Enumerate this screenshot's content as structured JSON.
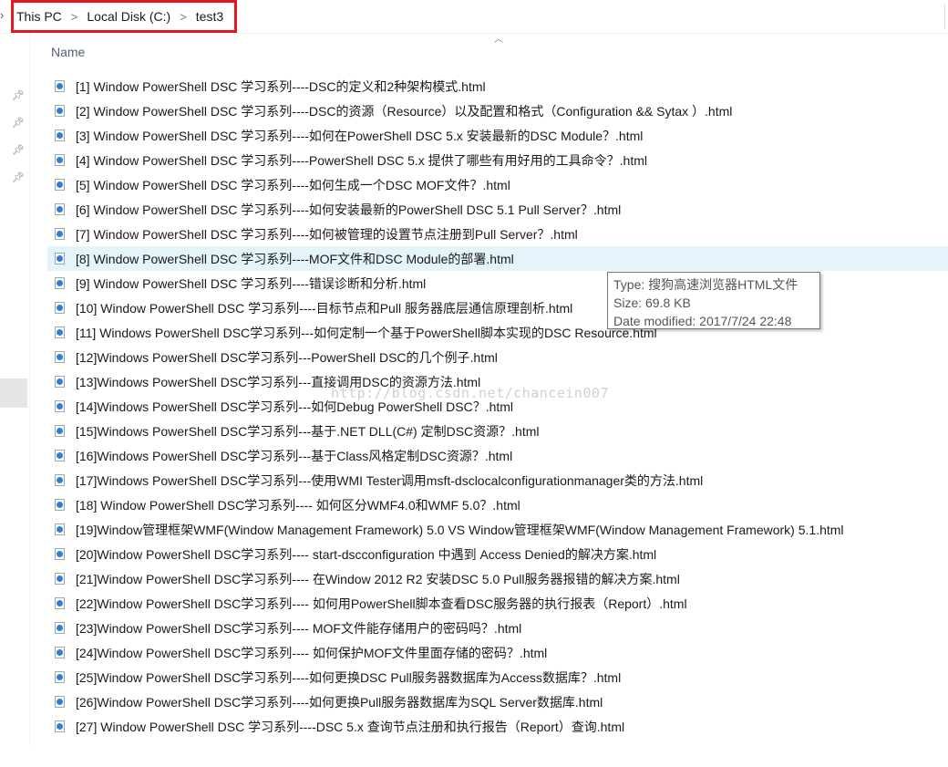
{
  "breadcrumb": {
    "items": [
      "This PC",
      "Local Disk (C:)",
      "test3"
    ],
    "separator": ">"
  },
  "header": {
    "name_column": "Name"
  },
  "files": [
    "[1] Window PowerShell DSC 学习系列----DSC的定义和2种架构模式.html",
    "[2] Window PowerShell DSC 学习系列----DSC的资源（Resource）以及配置和格式（Configuration && Sytax ）.html",
    "[3] Window PowerShell DSC 学习系列----如何在PowerShell DSC 5.x 安装最新的DSC Module？.html",
    "[4] Window PowerShell DSC 学习系列----PowerShell DSC 5.x 提供了哪些有用好用的工具命令？.html",
    "[5] Window PowerShell DSC 学习系列----如何生成一个DSC MOF文件？.html",
    "[6] Window PowerShell DSC 学习系列----如何安装最新的PowerShell DSC 5.1 Pull Server？.html",
    "[7] Window PowerShell DSC 学习系列----如何被管理的设置节点注册到Pull Server？.html",
    "[8] Window PowerShell DSC 学习系列----MOF文件和DSC Module的部署.html",
    "[9] Window PowerShell DSC 学习系列----错误诊断和分析.html",
    "[10] Window PowerShell DSC 学习系列----目标节点和Pull 服务器底层通信原理剖析.html",
    "[11] Windows PowerShell DSC学习系列---如何定制一个基于PowerShell脚本实现的DSC Resource.html",
    "[12]Windows PowerShell DSC学习系列---PowerShell DSC的几个例子.html",
    "[13]Windows PowerShell DSC学习系列---直接调用DSC的资源方法.html",
    "[14]Windows PowerShell DSC学习系列---如何Debug PowerShell DSC？.html",
    "[15]Windows PowerShell DSC学习系列---基于.NET DLL(C#) 定制DSC资源？.html",
    "[16]Windows PowerShell DSC学习系列---基于Class风格定制DSC资源？.html",
    "[17]Windows PowerShell DSC学习系列---使用WMI Tester调用msft-dsclocalconfigurationmanager类的方法.html",
    "[18] Window PowerShell DSC学习系列---- 如何区分WMF4.0和WMF 5.0？.html",
    "[19]Window管理框架WMF(Window Management Framework) 5.0 VS Window管理框架WMF(Window Management Framework) 5.1.html",
    "[20]Window PowerShell DSC学习系列---- start-dscconfiguration 中遇到 Access Denied的解决方案.html",
    "[21]Window PowerShell DSC学习系列---- 在Window 2012 R2 安装DSC 5.0 Pull服务器报错的解决方案.html",
    "[22]Window PowerShell DSC学习系列---- 如何用PowerShell脚本查看DSC服务器的执行报表（Report）.html",
    "[23]Window PowerShell DSC学习系列---- MOF文件能存储用户的密码吗？.html",
    "[24]Window PowerShell DSC学习系列---- 如何保护MOF文件里面存储的密码？.html",
    "[25]Window PowerShell DSC学习系列----如何更换DSC Pull服务器数据库为Access数据库？.html",
    "[26]Window PowerShell DSC学习系列----如何更换Pull服务器数据库为SQL Server数据库.html",
    "[27] Window PowerShell DSC 学习系列----DSC 5.x 查询节点注册和执行报告（Report）查询.html"
  ],
  "selected_index": 7,
  "tooltip": {
    "type": "Type: 搜狗高速浏览器HTML文件",
    "size": "Size: 69.8 KB",
    "modified": "Date modified: 2017/7/24 22:48"
  },
  "watermark": "http://blog.csdn.net/chancein007",
  "colors": {
    "highlight_border": "#e3171e",
    "selected_row": "#e5f3fb",
    "header_text": "#4c607a"
  }
}
